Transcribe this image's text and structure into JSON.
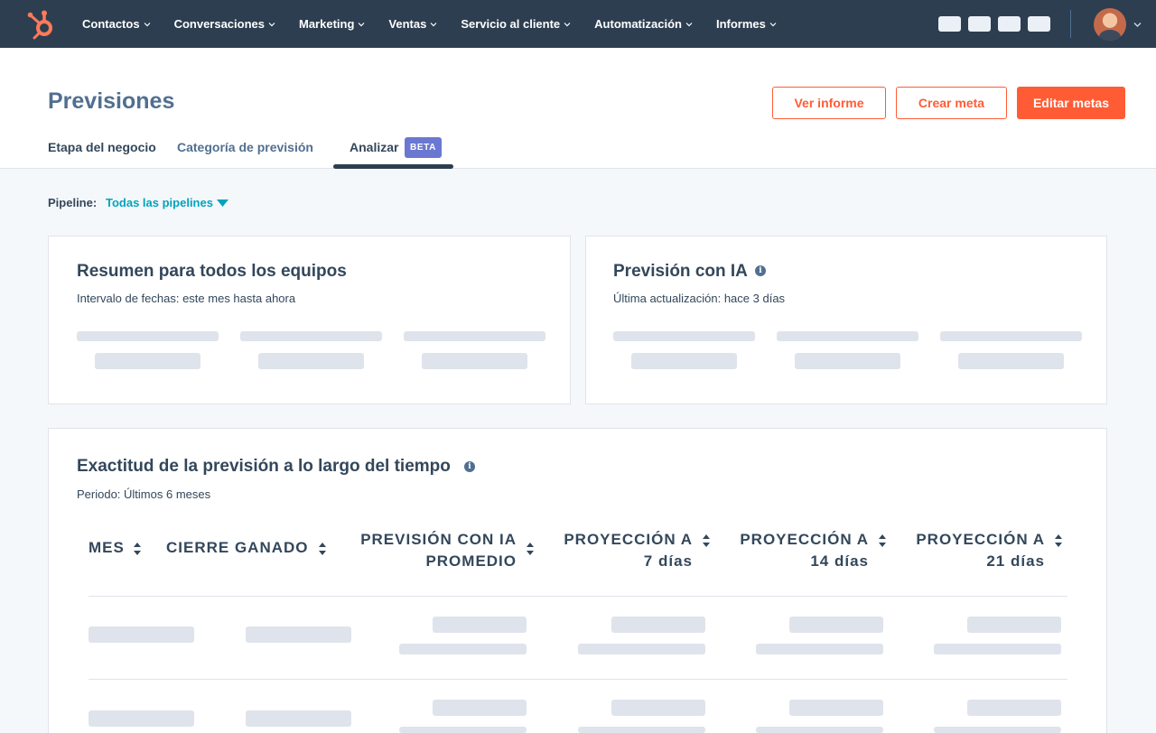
{
  "nav": {
    "items": [
      "Contactos",
      "Conversaciones",
      "Marketing",
      "Ventas",
      "Servicio al cliente",
      "Automatización",
      "Informes"
    ]
  },
  "header": {
    "title": "Previsiones",
    "buttons": {
      "view_report": "Ver informe",
      "create_goal": "Crear meta",
      "edit_goals": "Editar metas"
    },
    "tabs": {
      "stage": "Etapa del negocio",
      "category": "Categoría de previsión",
      "analyze": "Analizar"
    },
    "beta_badge": "BETA"
  },
  "pipeline": {
    "label": "Pipeline:",
    "value": "Todas las pipelines"
  },
  "summary_card": {
    "title": "Resumen para todos los equipos",
    "subtitle": "Intervalo de fechas: este mes hasta ahora"
  },
  "ai_card": {
    "title": "Previsión con IA",
    "subtitle": "Última actualización: hace 3 días"
  },
  "accuracy_card": {
    "title": "Exactitud de la previsión a lo largo del tiempo",
    "subtitle": "Periodo: Últimos 6 meses",
    "columns": {
      "month": "MES",
      "won": "CIERRE GANADO",
      "ai_line1": "PREVISIÓN CON IA",
      "ai_line2": "PROMEDIO",
      "p7_line1": "PROYECCIÓN A",
      "p7_line2": "7 días",
      "p14_line1": "PROYECCIÓN A",
      "p14_line2": "14 días",
      "p21_line1": "PROYECCIÓN A",
      "p21_line2": "21 días"
    }
  },
  "colors": {
    "nav_bg": "#2d3e50",
    "accent": "#ff5c35",
    "link": "#00a4bd",
    "beta": "#6a78d1",
    "skeleton": "#dfe3eb"
  }
}
